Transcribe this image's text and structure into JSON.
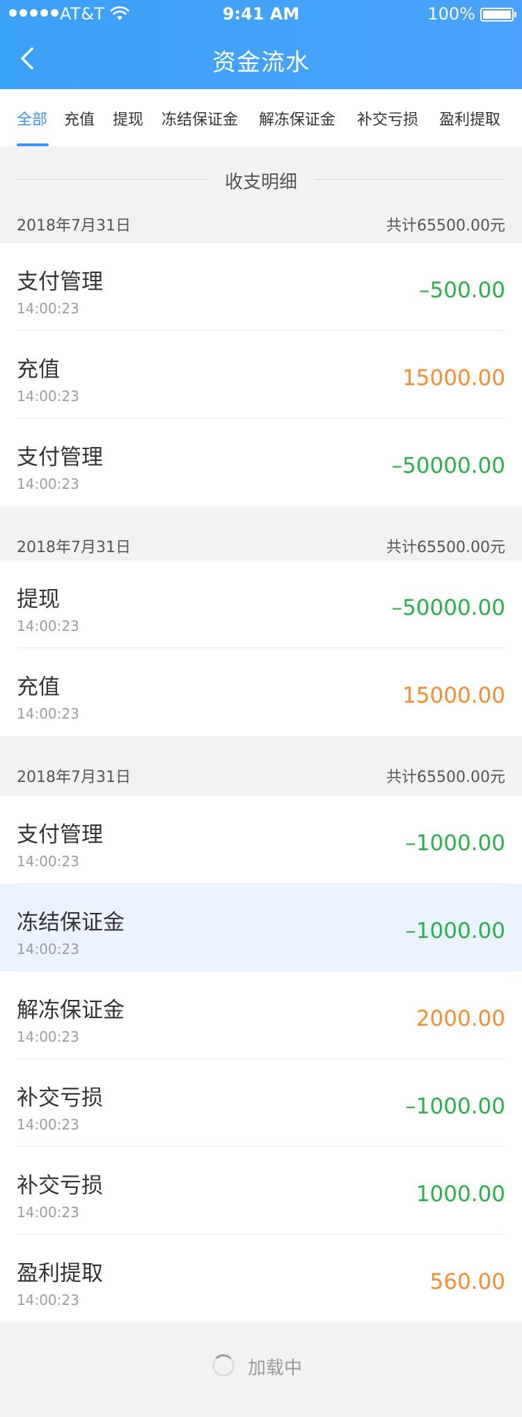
{
  "status_bar": {
    "carrier": "AT&T",
    "time": "9:41 AM",
    "battery": "100%"
  },
  "nav": {
    "title": "资金流水",
    "back_icon": "chevron-left-icon"
  },
  "tabs": [
    {
      "label": "全部",
      "active": true
    },
    {
      "label": "充值",
      "active": false
    },
    {
      "label": "提现",
      "active": false
    },
    {
      "label": "冻结保证金",
      "active": false
    },
    {
      "label": "解冻保证金",
      "active": false
    },
    {
      "label": "补交亏损",
      "active": false
    },
    {
      "label": "盈利提取",
      "active": false
    }
  ],
  "section": {
    "heading": "收支明细"
  },
  "groups": [
    {
      "date": "2018年7月31日",
      "total": "共计65500.00元",
      "items": [
        {
          "title": "支付管理",
          "time": "14:00:23",
          "amount": "–500.00",
          "type": "expense"
        },
        {
          "title": "充值",
          "time": "14:00:23",
          "amount": "15000.00",
          "type": "income"
        },
        {
          "title": "支付管理",
          "time": "14:00:23",
          "amount": "–50000.00",
          "type": "expense"
        }
      ]
    },
    {
      "date": "2018年7月31日",
      "total": "共计65500.00元",
      "items": [
        {
          "title": "提现",
          "time": "14:00:23",
          "amount": "–50000.00",
          "type": "expense"
        },
        {
          "title": "充值",
          "time": "14:00:23",
          "amount": "15000.00",
          "type": "income"
        }
      ]
    },
    {
      "date": "2018年7月31日",
      "total": "共计65500.00元",
      "items": [
        {
          "title": "支付管理",
          "time": "14:00:23",
          "amount": "–1000.00",
          "type": "expense"
        },
        {
          "title": "冻结保证金",
          "time": "14:00:23",
          "amount": "–1000.00",
          "type": "expense",
          "highlight": true
        },
        {
          "title": "解冻保证金",
          "time": "14:00:23",
          "amount": "2000.00",
          "type": "income"
        },
        {
          "title": "补交亏损",
          "time": "14:00:23",
          "amount": "–1000.00",
          "type": "expense"
        },
        {
          "title": "补交亏损",
          "time": "14:00:23",
          "amount": "1000.00",
          "type": "expense"
        },
        {
          "title": "盈利提取",
          "time": "14:00:23",
          "amount": "560.00",
          "type": "income"
        }
      ]
    }
  ],
  "footer": {
    "loading_text": "加载中"
  },
  "colors": {
    "header": "#4aa2fb",
    "accent": "#3d95f4",
    "expense": "#29b24b",
    "income": "#fa8c2f",
    "highlight_row": "#eaf3fe"
  }
}
